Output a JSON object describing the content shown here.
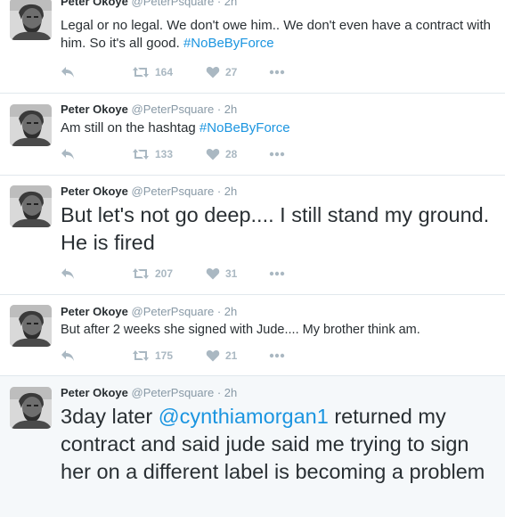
{
  "tweets": [
    {
      "name": "Peter Okoye",
      "handle": "@PeterPsquare",
      "separator": "·",
      "time": "2h",
      "text_before": "Legal or no legal. We don't owe him.. We don't even have a contract with him. So it's all good. ",
      "hashtag": "#NoBeByForce",
      "retweets": "164",
      "likes": "27"
    },
    {
      "name": "Peter Okoye",
      "handle": "@PeterPsquare",
      "separator": "·",
      "time": "2h",
      "text_before": "Am still on the hashtag ",
      "hashtag": "#NoBeByForce",
      "retweets": "133",
      "likes": "28"
    },
    {
      "name": "Peter Okoye",
      "handle": "@PeterPsquare",
      "separator": "·",
      "time": "2h",
      "text": "But let's not go deep.... I still stand my ground. He is fired",
      "retweets": "207",
      "likes": "31"
    },
    {
      "name": "Peter Okoye",
      "handle": "@PeterPsquare",
      "separator": "·",
      "time": "2h",
      "text": "But after 2 weeks she signed with Jude.... My brother think am.",
      "retweets": "175",
      "likes": "21"
    },
    {
      "name": "Peter Okoye",
      "handle": "@PeterPsquare",
      "separator": "·",
      "time": "2h",
      "text_before": "3day later ",
      "mention": "@cynthiamorgan1",
      "text_after": " returned my contract and said jude said me trying to sign her on a different label is becoming a problem"
    }
  ],
  "icons": {
    "reply": "reply-icon",
    "retweet": "retweet-icon",
    "like": "heart-icon",
    "more": "more-icon"
  },
  "colors": {
    "link": "#1b95e0",
    "muted": "#8899a6",
    "action": "#aab8c2",
    "text": "#292f33",
    "highlight_bg": "#f5f8fa"
  }
}
